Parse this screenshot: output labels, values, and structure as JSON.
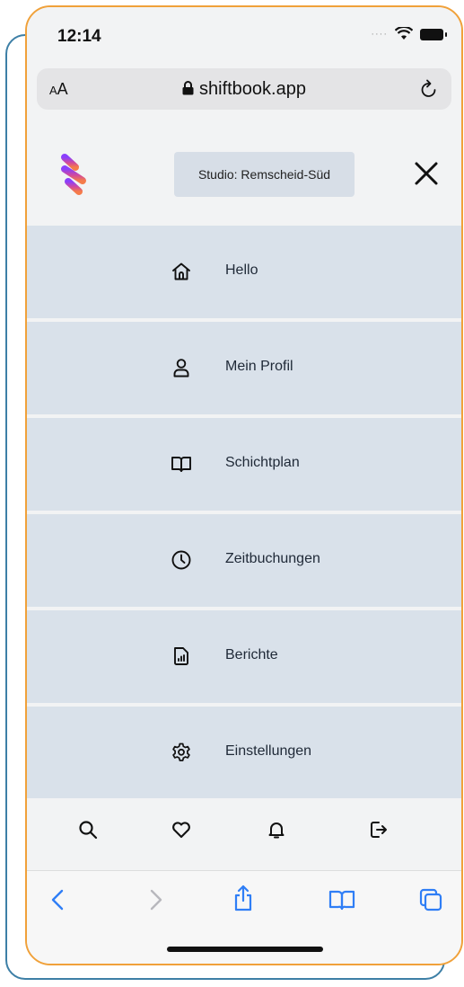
{
  "status_bar": {
    "time": "12:14"
  },
  "browser": {
    "text_size_label_small": "A",
    "text_size_label_large": "A",
    "domain": "shiftbook.app"
  },
  "header": {
    "studio_label": "Studio: Remscheid-Süd"
  },
  "menu": {
    "items": [
      {
        "label": "Hello",
        "icon": "home-icon"
      },
      {
        "label": "Mein Profil",
        "icon": "user-icon"
      },
      {
        "label": "Schichtplan",
        "icon": "book-icon"
      },
      {
        "label": "Zeitbuchungen",
        "icon": "clock-icon"
      },
      {
        "label": "Berichte",
        "icon": "report-icon"
      },
      {
        "label": "Einstellungen",
        "icon": "gear-icon"
      }
    ]
  },
  "bottom_nav": {
    "icons": [
      "search-icon",
      "heart-icon",
      "bell-icon",
      "logout-icon"
    ]
  },
  "safari_toolbar": {
    "icons": [
      "back-icon",
      "forward-icon",
      "share-icon",
      "bookmarks-icon",
      "tabs-icon"
    ]
  },
  "colors": {
    "accent_blue": "#2f7ef6",
    "menu_bg": "#d9e1ea",
    "frame_orange": "#f0a13a",
    "frame_blue": "#3d7fa6"
  }
}
